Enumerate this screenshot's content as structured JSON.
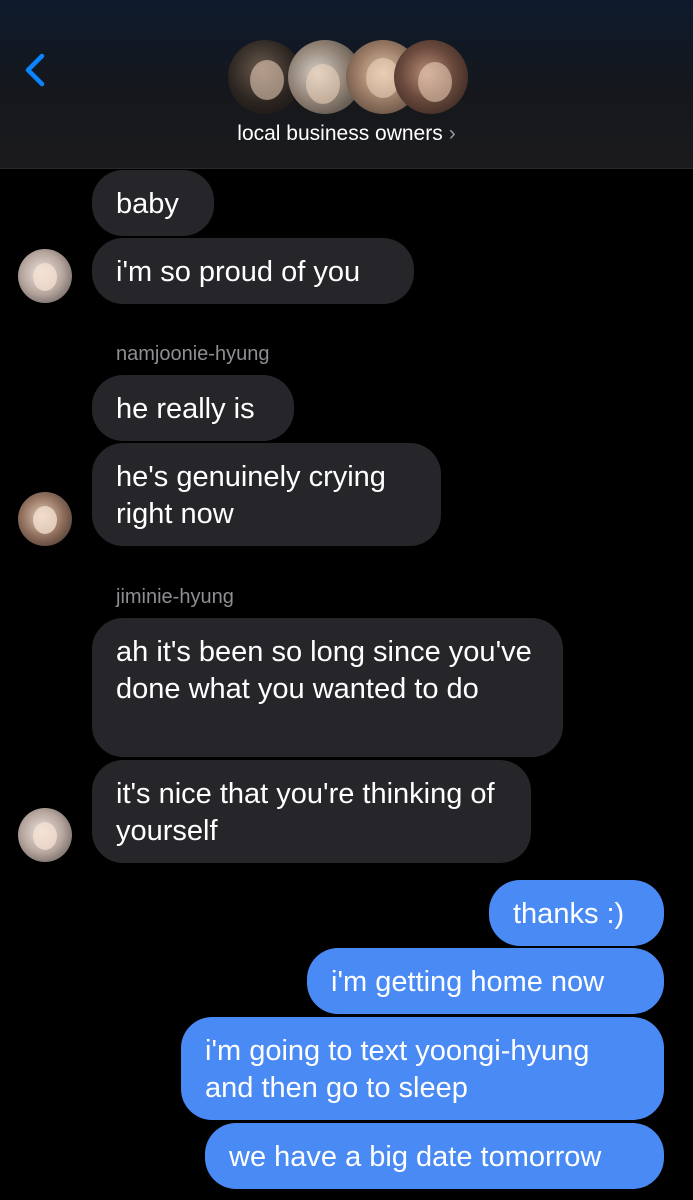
{
  "header": {
    "back_icon": "chevron-left-icon",
    "group_name": "local business owners",
    "chevron": "›",
    "accent_color": "#0a84ff"
  },
  "messages": [
    {
      "direction": "incoming",
      "text": "baby"
    },
    {
      "direction": "incoming",
      "text": "i'm so proud of you"
    },
    {
      "direction": "incoming",
      "sender": "namjoonie-hyung",
      "text": "he really is"
    },
    {
      "direction": "incoming",
      "text": "he's genuinely crying right now"
    },
    {
      "direction": "incoming",
      "sender": "jiminie-hyung",
      "text": "ah it's been so long since you've done what you wanted to do"
    },
    {
      "direction": "incoming",
      "text": "it's nice that you're thinking of yourself"
    },
    {
      "direction": "outgoing",
      "text": "thanks :)"
    },
    {
      "direction": "outgoing",
      "text": "i'm getting home now"
    },
    {
      "direction": "outgoing",
      "text": "i'm going to text yoongi-hyung and then go to sleep"
    },
    {
      "direction": "outgoing",
      "text": "we have a big date tomorrow"
    }
  ],
  "colors": {
    "incoming_bubble": "#26252a",
    "outgoing_bubble": "#4a8af4",
    "sender_label": "#8e8e93",
    "background": "#000000"
  }
}
